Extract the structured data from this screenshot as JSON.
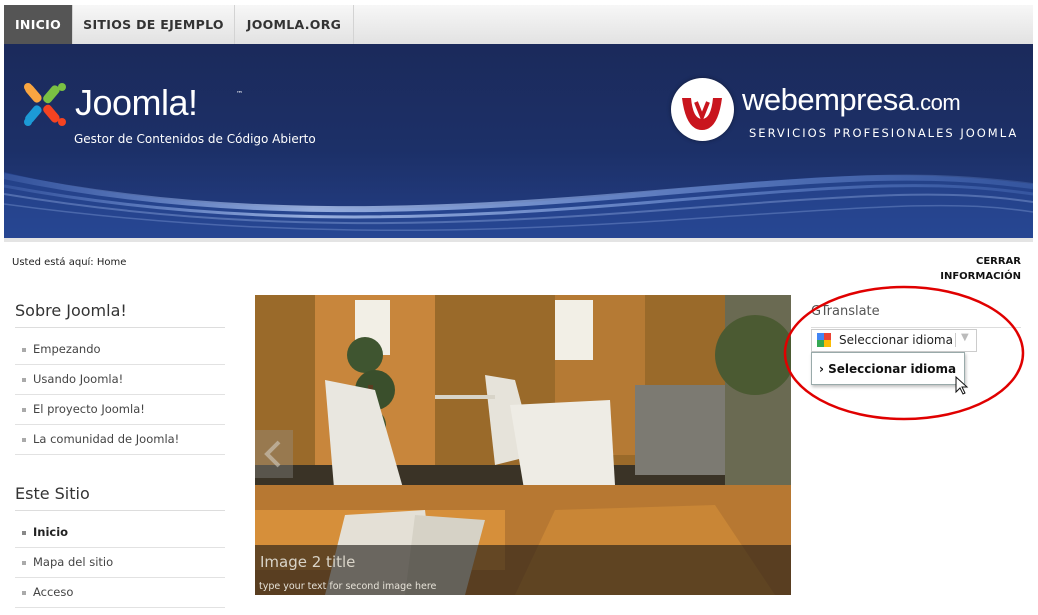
{
  "nav": {
    "tabs": [
      {
        "label": "INICIO",
        "active": true
      },
      {
        "label": "SITIOS DE EJEMPLO",
        "active": false
      },
      {
        "label": "JOOMLA.ORG",
        "active": false
      }
    ]
  },
  "banner": {
    "joomla_logo_text": "Joomla!",
    "joomla_tm": "™",
    "joomla_slogan": "Gestor de Contenidos de Código Abierto",
    "webempresa_name": "webempresa",
    "webempresa_com": ".com",
    "webempresa_tagline": "SERVICIOS PROFESIONALES JOOMLA"
  },
  "breadcrumb": "Usted está aquí: Home",
  "close_info": [
    "CERRAR",
    "INFORMACIÓN"
  ],
  "menu_sobre": {
    "title": "Sobre Joomla!",
    "items": [
      "Empezando",
      "Usando Joomla!",
      "El proyecto Joomla!",
      "La comunidad de Joomla!"
    ]
  },
  "menu_sitio": {
    "title": "Este Sitio",
    "items": [
      "Inicio",
      "Mapa del sitio",
      "Acceso"
    ],
    "current": "Inicio"
  },
  "slider": {
    "caption_title": "Image 2 title",
    "caption_text": "type your text for second image here"
  },
  "gtranslate": {
    "title": "GTranslate",
    "select_label": "Seleccionar idioma",
    "dropdown_option": "› Seleccionar idioma"
  },
  "colors": {
    "active_tab": "#555555",
    "banner_blue": "#1c3068",
    "annotation_red": "#e00000"
  }
}
